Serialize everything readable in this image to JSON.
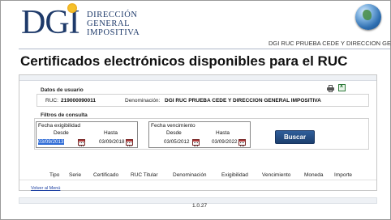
{
  "header": {
    "logo": "DGI",
    "org_line1": "DIRECCIÓN",
    "org_line2": "GENERAL",
    "org_line3": "IMPOSITIVA",
    "user_text": "DGI RUC PRUEBA CEDE Y DIRECCION GENE"
  },
  "page": {
    "title": "Certificados electrónicos disponibles para el RUC"
  },
  "user_data": {
    "section_title": "Datos de usuario",
    "ruc_label": "RUC:",
    "ruc_value": "219000090011",
    "denominacion_label": "Denominación:",
    "denominacion_value": "DGI RUC PRUEBA CEDE Y DIRECCION GENERAL IMPOSITIVA"
  },
  "filters": {
    "section_title": "Filtros de consulta",
    "exigibilidad": {
      "caption": "Fecha exigibilidad",
      "desde_label": "Desde",
      "hasta_label": "Hasta",
      "desde_value": "03/09/2013",
      "hasta_value": "03/09/2018"
    },
    "vencimiento": {
      "caption": "Fecha vencimiento",
      "desde_label": "Desde",
      "hasta_label": "Hasta",
      "desde_value": "03/05/2012",
      "hasta_value": "03/09/2022"
    },
    "search_button": "Buscar"
  },
  "table": {
    "columns": [
      "Tipo",
      "Serie",
      "Certificado",
      "RUC Titular",
      "Denominación",
      "Exigibilidad",
      "Vencimiento",
      "Moneda",
      "Importe"
    ]
  },
  "links": {
    "back": "Volver al Menú"
  },
  "footer": {
    "version": "1.0.27"
  },
  "icons": {
    "globe": "globe-icon",
    "calendar": "calendar-icon",
    "print": "printer-icon",
    "excel": "excel-export-icon"
  },
  "colors": {
    "brand": "#1e3a6a",
    "button": "#1c3f6e",
    "selection": "#2e6bd6"
  }
}
